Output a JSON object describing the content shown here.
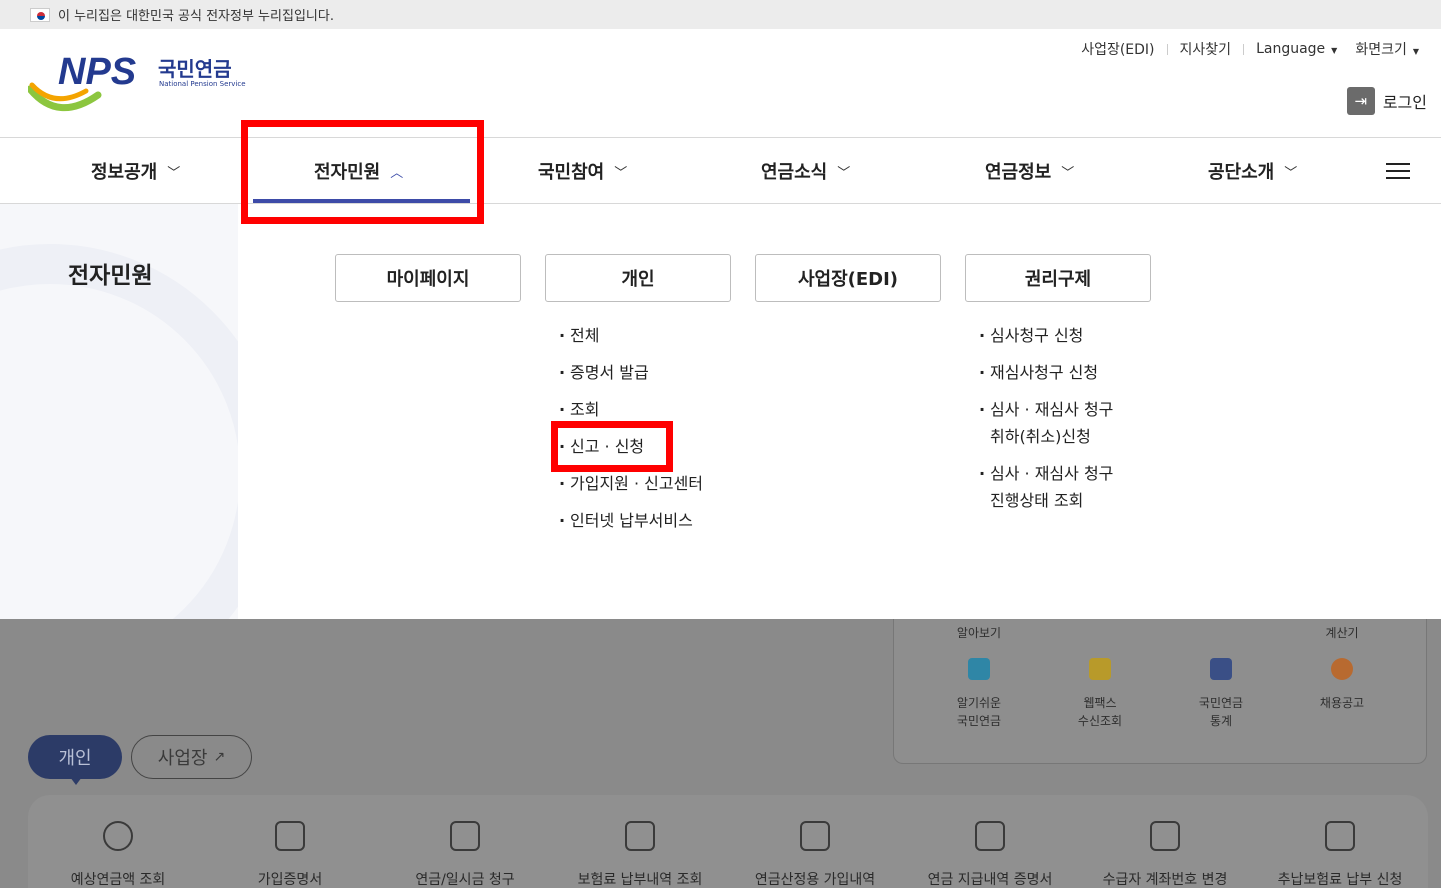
{
  "gov_banner": {
    "text": "이 누리집은 대한민국 공식 전자정부 누리집입니다."
  },
  "logo": {
    "brand": "NPS",
    "korean": "국민연금",
    "english": "National Pension Service"
  },
  "utility": {
    "edi": "사업장(EDI)",
    "branch": "지사찾기",
    "language": "Language",
    "screen_size": "화면크기",
    "login": "로그인"
  },
  "gnb": [
    {
      "label": "정보공개",
      "chevron": "chevron-down-icon"
    },
    {
      "label": "전자민원",
      "chevron": "chevron-up-icon",
      "active": true
    },
    {
      "label": "국민참여",
      "chevron": "chevron-down-icon"
    },
    {
      "label": "연금소식",
      "chevron": "chevron-down-icon"
    },
    {
      "label": "연금정보",
      "chevron": "chevron-down-icon"
    },
    {
      "label": "공단소개",
      "chevron": "chevron-down-icon"
    }
  ],
  "mega": {
    "title": "전자민원",
    "categories": [
      "마이페이지",
      "개인",
      "사업장(EDI)",
      "권리구제"
    ],
    "personal": [
      "전체",
      "증명서 발급",
      "조회",
      "신고 · 신청",
      "가입지원 · 신고센터",
      "인터넷 납부서비스"
    ],
    "remedy": [
      {
        "line1": "심사청구 신청",
        "line2": ""
      },
      {
        "line1": "재심사청구 신청",
        "line2": ""
      },
      {
        "line1": "심사 · 재심사 청구",
        "line2": "취하(취소)신청"
      },
      {
        "line1": "심사 · 재심사 청구",
        "line2": "진행상태 조회"
      }
    ]
  },
  "quick_menu": {
    "top_row": [
      "알아보기",
      "계산기"
    ],
    "items": [
      {
        "line1": "알기쉬운",
        "line2": "국민연금",
        "icon": "monitor-icon",
        "color": "#2f86a6"
      },
      {
        "line1": "웹팩스",
        "line2": "수신조회",
        "icon": "fax-icon",
        "color": "#b89a2a"
      },
      {
        "line1": "국민연금",
        "line2": "통계",
        "icon": "chart-icon",
        "color": "#3a4f86"
      },
      {
        "line1": "채용공고",
        "line2": "",
        "icon": "speech-icon",
        "color": "#b86a30"
      }
    ]
  },
  "service_tabs": {
    "individual": "개인",
    "business": "사업장"
  },
  "services": [
    "예상연금액 조회",
    "가입증명서",
    "연금/일시금 청구",
    "보험료 납부내역 조회",
    "연금산정용 가입내역",
    "연금 지급내역 증명서",
    "수급자 계좌번호 변경",
    "추납보험료 납부 신청"
  ],
  "colors": {
    "accent": "#3d4ba8",
    "highlight": "#ff0000",
    "overlay": "#8a8a8a"
  }
}
